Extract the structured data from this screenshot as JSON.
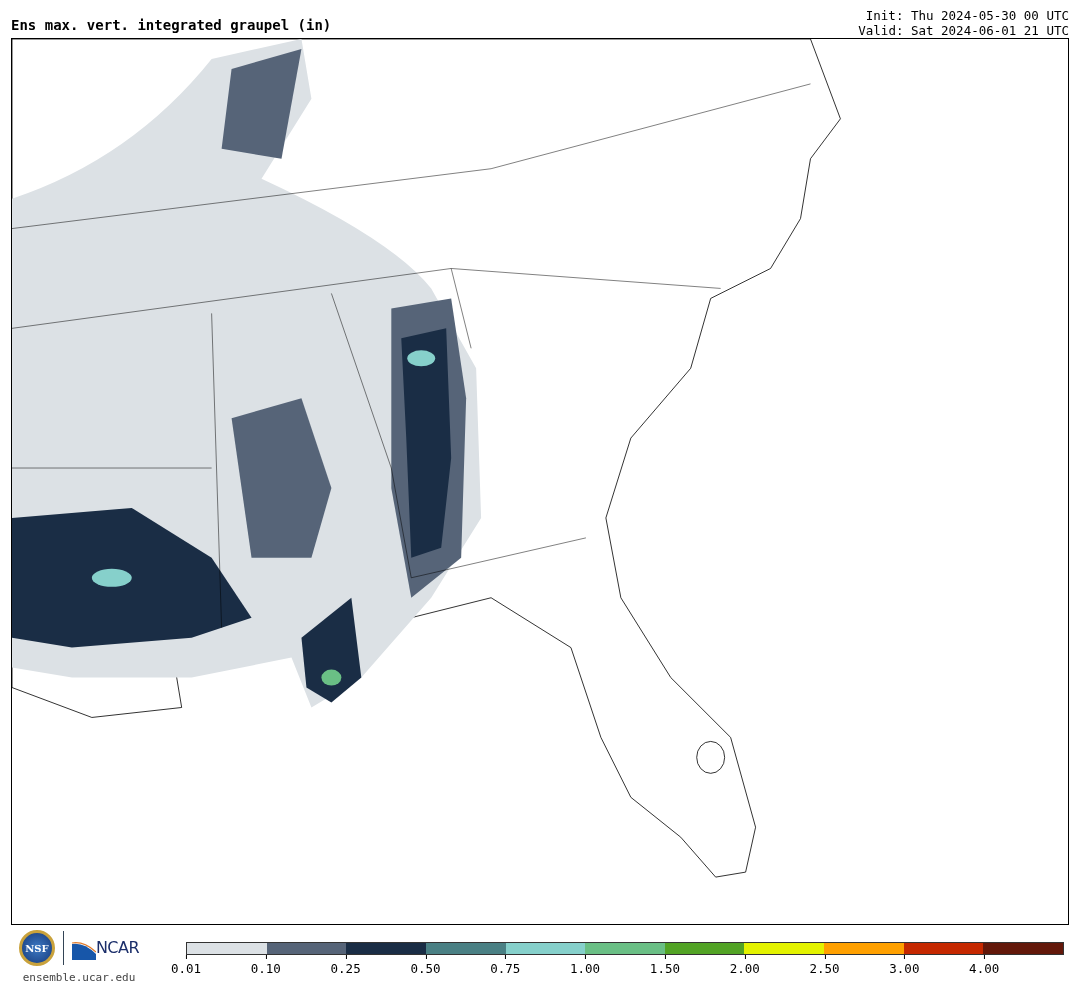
{
  "title": "Ens max. vert. integrated graupel (in)",
  "init": "Init: Thu 2024-05-30 00 UTC",
  "valid": "Valid: Sat 2024-06-01 21 UTC",
  "logos": {
    "nsf": "NSF",
    "ncar": "NCAR",
    "url": "ensemble.ucar.edu"
  },
  "colorbar": {
    "bins": [
      {
        "color": "#dce1e5"
      },
      {
        "color": "#566478"
      },
      {
        "color": "#1a2d45"
      },
      {
        "color": "#4a8084"
      },
      {
        "color": "#86d0cb"
      },
      {
        "color": "#6abf85"
      },
      {
        "color": "#52a325"
      },
      {
        "color": "#e3f200"
      },
      {
        "color": "#ffa000"
      },
      {
        "color": "#c52800"
      },
      {
        "color": "#63180a"
      }
    ],
    "ticks": [
      "0.01",
      "0.10",
      "0.25",
      "0.50",
      "0.75",
      "1.00",
      "1.50",
      "2.00",
      "2.50",
      "3.00",
      "4.00"
    ]
  }
}
